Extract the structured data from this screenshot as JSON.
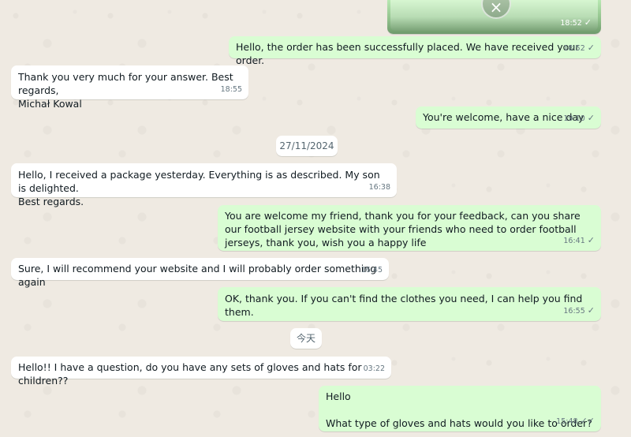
{
  "media_message": {
    "time": "18:52",
    "status": "✓",
    "close_icon": "×"
  },
  "messages": [
    {
      "id": "m1",
      "direction": "out",
      "text": "Hello, the order has been successfully placed. We have received your order.",
      "time": "18:52",
      "status": "✓"
    },
    {
      "id": "m2",
      "direction": "in",
      "text": "Thank you very much for your answer. Best regards,\nMichał Kowal",
      "time": "18:55"
    },
    {
      "id": "m3",
      "direction": "out",
      "text": "You're welcome, have a nice day",
      "time": "19:10",
      "status": "✓"
    },
    {
      "id": "m4",
      "direction": "in",
      "text": "Hello, I received a package yesterday. Everything is as described. My son is delighted.\nBest regards.",
      "time": "16:38"
    },
    {
      "id": "m5",
      "direction": "out",
      "text": "You are welcome my friend, thank you for your feedback, can you share our football jersey website with your friends who need to order football jerseys, thank you, wish you a happy life",
      "time": "16:41",
      "status": "✓"
    },
    {
      "id": "m6",
      "direction": "in",
      "text": "Sure, I will recommend your website and I will probably order something again",
      "time": "16:45"
    },
    {
      "id": "m7",
      "direction": "out",
      "text": "OK, thank you. If you can't find the clothes you need, I can help you find them.",
      "time": "16:55",
      "status": "✓"
    },
    {
      "id": "m8",
      "direction": "in",
      "text": "Hello!! I have a question, do you have any sets of gloves and hats for children??",
      "time": "03:22"
    },
    {
      "id": "m9",
      "direction": "out",
      "text": "Hello\n\nWhat type of gloves and hats would you like to order?",
      "time": "15:48",
      "status": "✓✓"
    }
  ],
  "date_separators": [
    {
      "id": "d1",
      "label": "27/11/2024"
    },
    {
      "id": "d2",
      "label": "今天"
    }
  ],
  "colors": {
    "background": "#efeae2",
    "incoming_bubble": "#ffffff",
    "outgoing_bubble": "#d9fdd3",
    "meta_text": "#667781"
  }
}
